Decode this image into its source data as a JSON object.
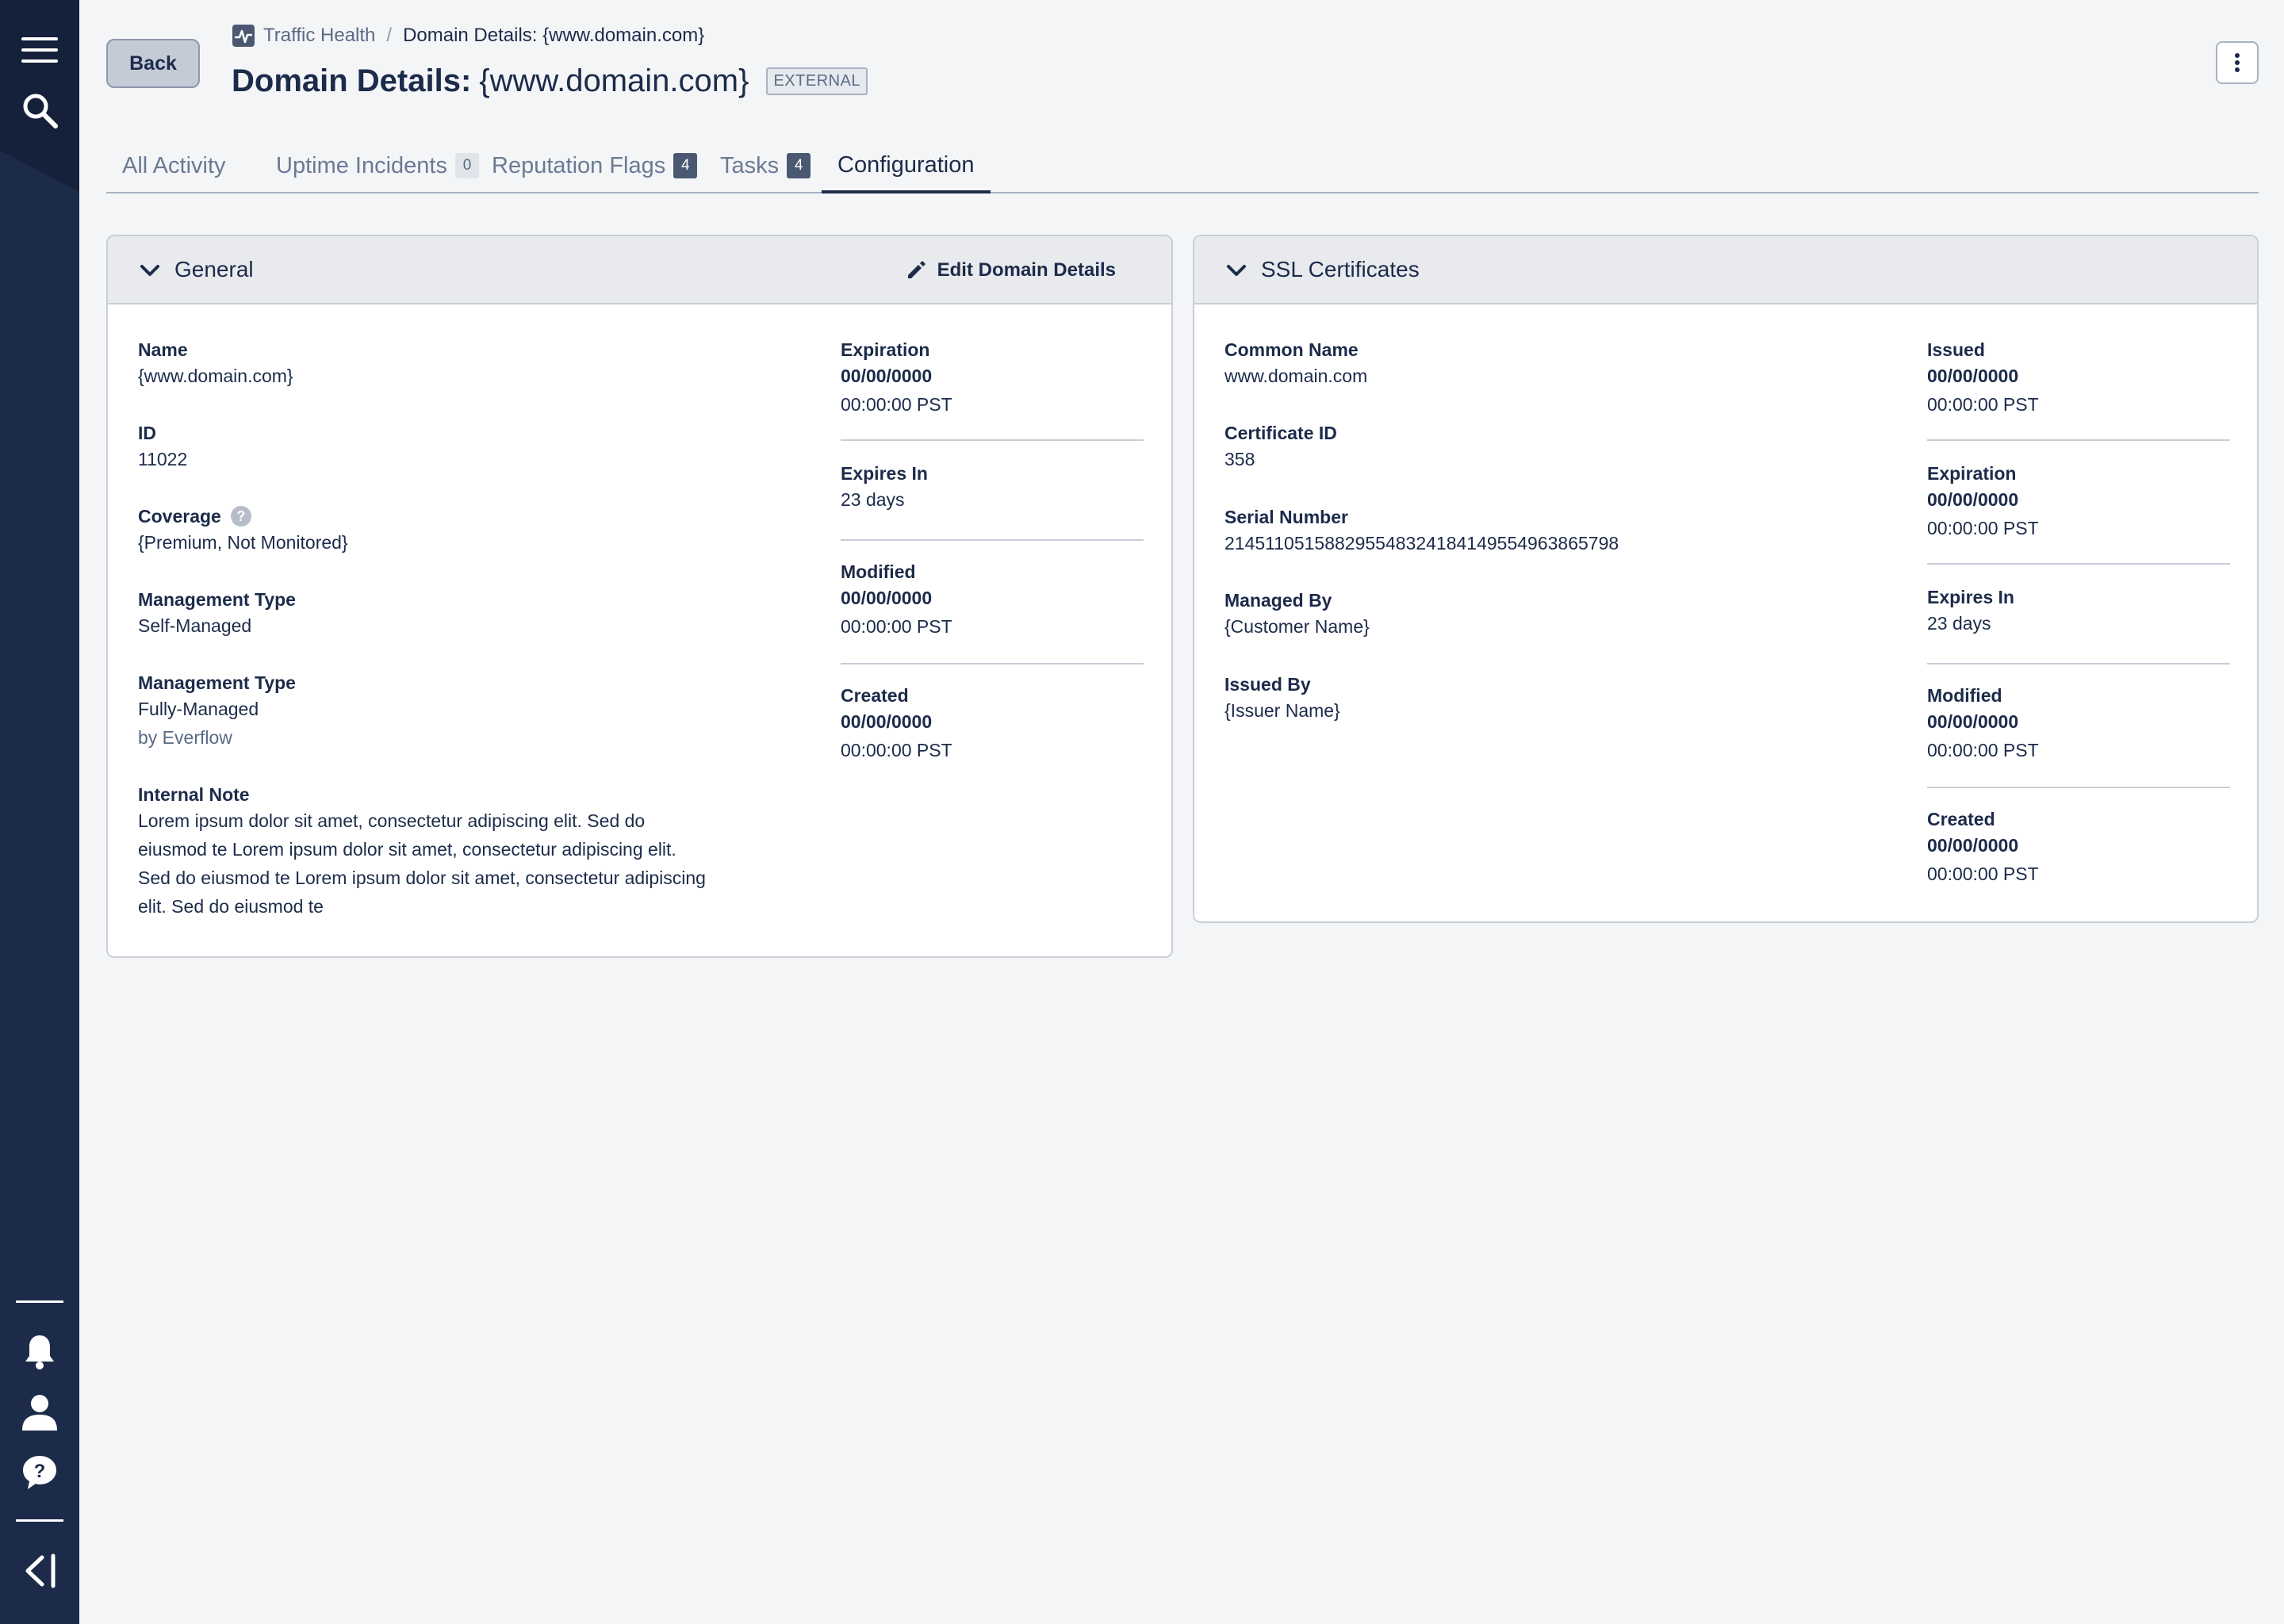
{
  "breadcrumb": {
    "section": "Traffic Health",
    "separator": "/",
    "current": "Domain Details: {www.domain.com}"
  },
  "header": {
    "title_prefix": "Domain Details:",
    "title_value": "{www.domain.com}",
    "badge": "EXTERNAL",
    "back_label": "Back"
  },
  "tabs": [
    {
      "label": "All Activity"
    },
    {
      "label": "Uptime Incidents",
      "count": "0"
    },
    {
      "label": "Reputation Flags",
      "count": "4"
    },
    {
      "label": "Tasks",
      "count": "4"
    },
    {
      "label": "Configuration",
      "active": true
    }
  ],
  "general": {
    "title": "General",
    "edit_label": "Edit Domain Details",
    "name_label": "Name",
    "name_value": "{www.domain.com}",
    "id_label": "ID",
    "id_value": "11022",
    "coverage_label": "Coverage",
    "coverage_help": "?",
    "coverage_value": "{Premium, Not Monitored}",
    "mgmt1_label": "Management Type",
    "mgmt1_value": "Self-Managed",
    "mgmt2_label": "Management Type",
    "mgmt2_value": "Fully-Managed",
    "mgmt2_by": "by Everflow",
    "note_label": "Internal Note",
    "note_value": "Lorem ipsum dolor sit amet, consectetur adipiscing elit. Sed do eiusmod te Lorem ipsum dolor sit amet, consectetur adipiscing elit. Sed do eiusmod te Lorem ipsum dolor sit amet, consectetur adipiscing elit. Sed do eiusmod te",
    "expiration_label": "Expiration",
    "expiration_date": "00/00/0000",
    "expiration_time": "00:00:00 PST",
    "expires_in_label": "Expires In",
    "expires_in_value": "23 days",
    "modified_label": "Modified",
    "modified_date": "00/00/0000",
    "modified_time": "00:00:00 PST",
    "created_label": "Created",
    "created_date": "00/00/0000",
    "created_time": "00:00:00 PST"
  },
  "ssl": {
    "title": "SSL Certificates",
    "common_name_label": "Common Name",
    "common_name_value": "www.domain.com",
    "cert_id_label": "Certificate ID",
    "cert_id_value": "358",
    "serial_label": "Serial Number",
    "serial_value": "214511051588295548324184149554963865798",
    "managed_by_label": "Managed By",
    "managed_by_value": "{Customer Name}",
    "issued_by_label": "Issued By",
    "issued_by_value": "{Issuer Name}",
    "issued_label": "Issued",
    "issued_date": "00/00/0000",
    "issued_time": "00:00:00 PST",
    "expiration_label": "Expiration",
    "expiration_date": "00/00/0000",
    "expiration_time": "00:00:00 PST",
    "expires_in_label": "Expires In",
    "expires_in_value": "23 days",
    "modified_label": "Modified",
    "modified_date": "00/00/0000",
    "modified_time": "00:00:00 PST",
    "created_label": "Created",
    "created_date": "00/00/0000",
    "created_time": "00:00:00 PST"
  },
  "sidebar": {
    "icons": [
      "menu-icon",
      "search-icon",
      "bell-icon",
      "user-icon",
      "help-icon",
      "collapse-icon"
    ]
  },
  "colors": {
    "sidebar_bg": "#1c2b4a",
    "text_primary": "#1c2b4a",
    "page_bg": "#f4f5f7"
  }
}
